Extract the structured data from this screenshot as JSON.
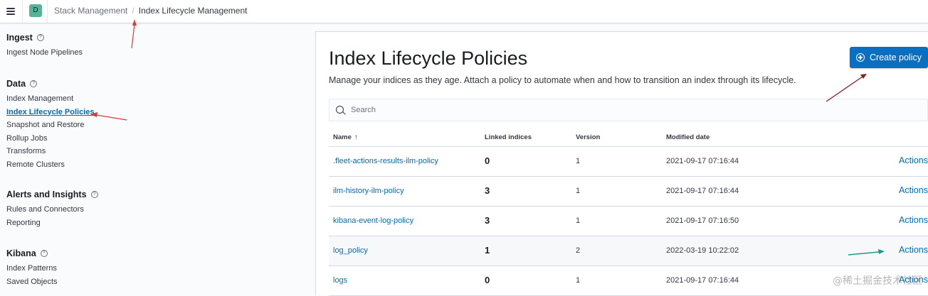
{
  "header": {
    "space_initial": "D",
    "breadcrumbs": [
      "Stack Management",
      "Index Lifecycle Management"
    ],
    "breadcrumb_separator": "/"
  },
  "sidebar": {
    "sections": [
      {
        "title": "Ingest",
        "items": [
          {
            "label": "Ingest Node Pipelines"
          }
        ]
      },
      {
        "title": "Data",
        "items": [
          {
            "label": "Index Management"
          },
          {
            "label": "Index Lifecycle Policies",
            "active": true
          },
          {
            "label": "Snapshot and Restore"
          },
          {
            "label": "Rollup Jobs"
          },
          {
            "label": "Transforms"
          },
          {
            "label": "Remote Clusters"
          }
        ]
      },
      {
        "title": "Alerts and Insights",
        "items": [
          {
            "label": "Rules and Connectors"
          },
          {
            "label": "Reporting"
          }
        ]
      },
      {
        "title": "Kibana",
        "items": [
          {
            "label": "Index Patterns"
          },
          {
            "label": "Saved Objects"
          }
        ]
      }
    ]
  },
  "main": {
    "title": "Index Lifecycle Policies",
    "description": "Manage your indices as they age. Attach a policy to automate when and how to transition an index through its lifecycle.",
    "create_button": "Create policy",
    "search_placeholder": "Search",
    "columns": {
      "name": "Name",
      "linked": "Linked indices",
      "version": "Version",
      "modified": "Modified date"
    },
    "sort_icon": "↑",
    "rows": [
      {
        "name": ".fleet-actions-results-ilm-policy",
        "linked": "0",
        "version": "1",
        "modified": "2021-09-17 07:16:44",
        "actions": "Actions"
      },
      {
        "name": "ilm-history-ilm-policy",
        "linked": "3",
        "version": "1",
        "modified": "2021-09-17 07:16:44",
        "actions": "Actions"
      },
      {
        "name": "kibana-event-log-policy",
        "linked": "3",
        "version": "1",
        "modified": "2021-09-17 07:16:50",
        "actions": "Actions"
      },
      {
        "name": "log_policy",
        "linked": "1",
        "version": "2",
        "modified": "2022-03-19 10:22:02",
        "actions": "Actions"
      },
      {
        "name": "logs",
        "linked": "0",
        "version": "1",
        "modified": "2021-09-17 07:16:44",
        "actions": "Actions"
      }
    ]
  },
  "watermark": "@稀土掘金技术社区",
  "colors": {
    "accent": "#0a6fc1",
    "link": "#006bb8",
    "avatar": "#54b399",
    "annotation_arrow": "#d83a3a",
    "annotation_arrow_teal": "#1a9a8a"
  }
}
